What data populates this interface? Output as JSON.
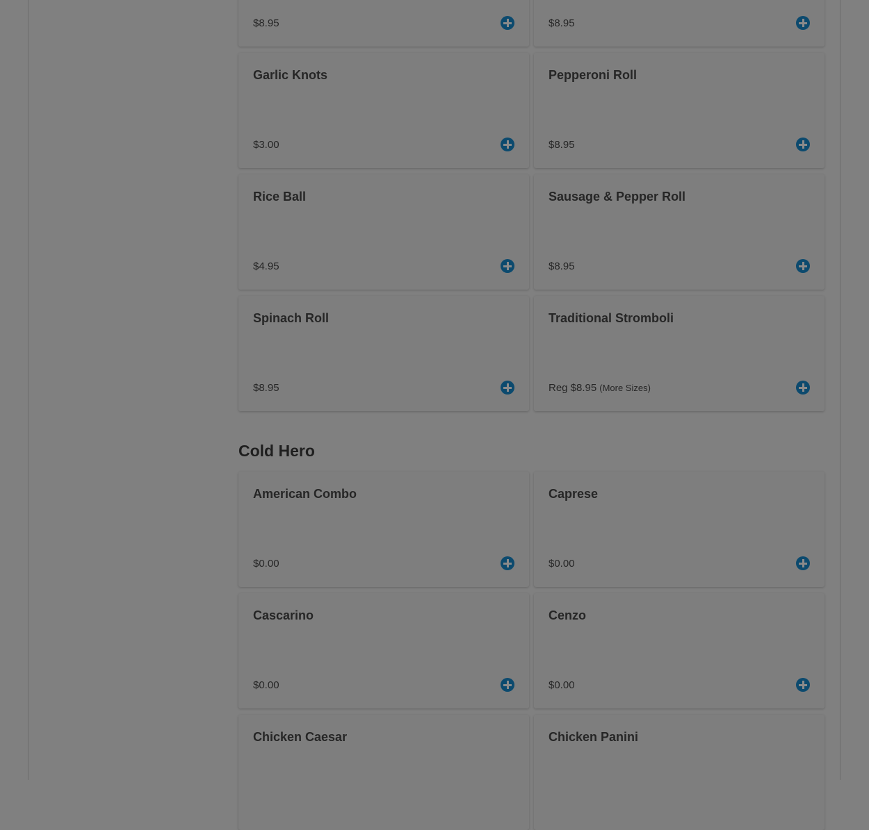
{
  "section_top": {
    "items": [
      {
        "name": "",
        "price": "$8.95"
      },
      {
        "name": "",
        "price": "$8.95"
      },
      {
        "name": "Garlic Knots",
        "price": "$3.00"
      },
      {
        "name": "Pepperoni Roll",
        "price": "$8.95"
      },
      {
        "name": "Rice Ball",
        "price": "$4.95"
      },
      {
        "name": "Sausage & Pepper Roll",
        "price": "$8.95"
      },
      {
        "name": "Spinach Roll",
        "price": "$8.95"
      },
      {
        "name": "Traditional Stromboli",
        "price": "Reg $8.95",
        "more": "(More Sizes)"
      }
    ]
  },
  "cold_hero": {
    "title": "Cold Hero",
    "items": [
      {
        "name": "American Combo",
        "price": "$0.00"
      },
      {
        "name": "Caprese",
        "price": "$0.00"
      },
      {
        "name": "Cascarino",
        "price": "$0.00"
      },
      {
        "name": "Cenzo",
        "price": "$0.00"
      },
      {
        "name": "Chicken Caesar",
        "price": ""
      },
      {
        "name": "Chicken Panini",
        "price": ""
      }
    ]
  },
  "icons": {
    "add": "plus-circle-icon"
  },
  "colors": {
    "overlay": "#808080",
    "accent": "#0c4a6e"
  }
}
